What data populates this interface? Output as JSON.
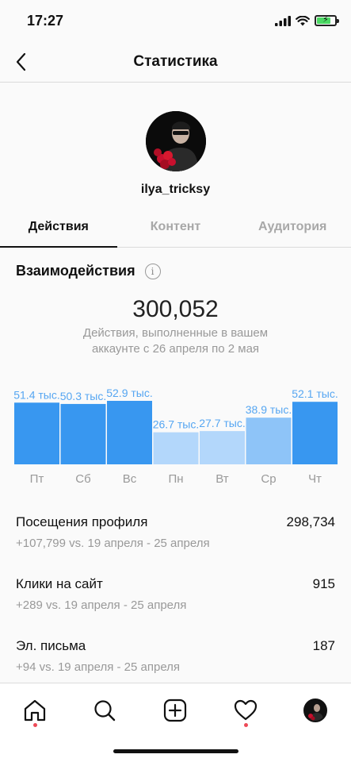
{
  "status_bar": {
    "time": "17:27"
  },
  "header": {
    "title": "Статистика",
    "back_icon": "chevron-left-icon"
  },
  "profile": {
    "username": "ilya_tricksy"
  },
  "tabs": [
    {
      "label": "Действия",
      "active": true
    },
    {
      "label": "Контент",
      "active": false
    },
    {
      "label": "Аудитория",
      "active": false
    }
  ],
  "interactions": {
    "title": "Взаимодействия",
    "total": "300,052",
    "caption": "Действия, выполненные в вашем аккаунте с 26 апреля по 2 мая"
  },
  "chart_data": {
    "type": "bar",
    "categories": [
      "Пт",
      "Сб",
      "Вс",
      "Пн",
      "Вт",
      "Ср",
      "Чт"
    ],
    "values": [
      51.4,
      50.3,
      52.9,
      26.7,
      27.7,
      38.9,
      52.1
    ],
    "data_labels": [
      "51.4 тыс.",
      "50.3 тыс.",
      "52.9 тыс.",
      "26.7 тыс.",
      "27.7 тыс.",
      "38.9 тыс.",
      "52.1 тыс."
    ],
    "unit": "тыс.",
    "ylim": [
      0,
      52.9
    ],
    "colors": [
      "#3897f0",
      "#3897f0",
      "#3897f0",
      "#b3d7fb",
      "#b3d7fb",
      "#8ec4f8",
      "#3897f0"
    ],
    "label_color": "#3897f0"
  },
  "metrics": [
    {
      "label": "Посещения профиля",
      "value": "298,734",
      "delta": "+107,799 vs. 19 апреля - 25 апреля"
    },
    {
      "label": "Клики на сайт",
      "value": "915",
      "delta": "+289 vs. 19 апреля - 25 апреля"
    },
    {
      "label": "Эл. письма",
      "value": "187",
      "delta": "+94 vs. 19 апреля - 25 апреля"
    }
  ],
  "bottom_nav": [
    {
      "icon": "home-icon",
      "notification": true
    },
    {
      "icon": "search-icon",
      "notification": false
    },
    {
      "icon": "add-post-icon",
      "notification": false
    },
    {
      "icon": "heart-icon",
      "notification": true
    },
    {
      "icon": "profile-avatar",
      "notification": false
    }
  ]
}
